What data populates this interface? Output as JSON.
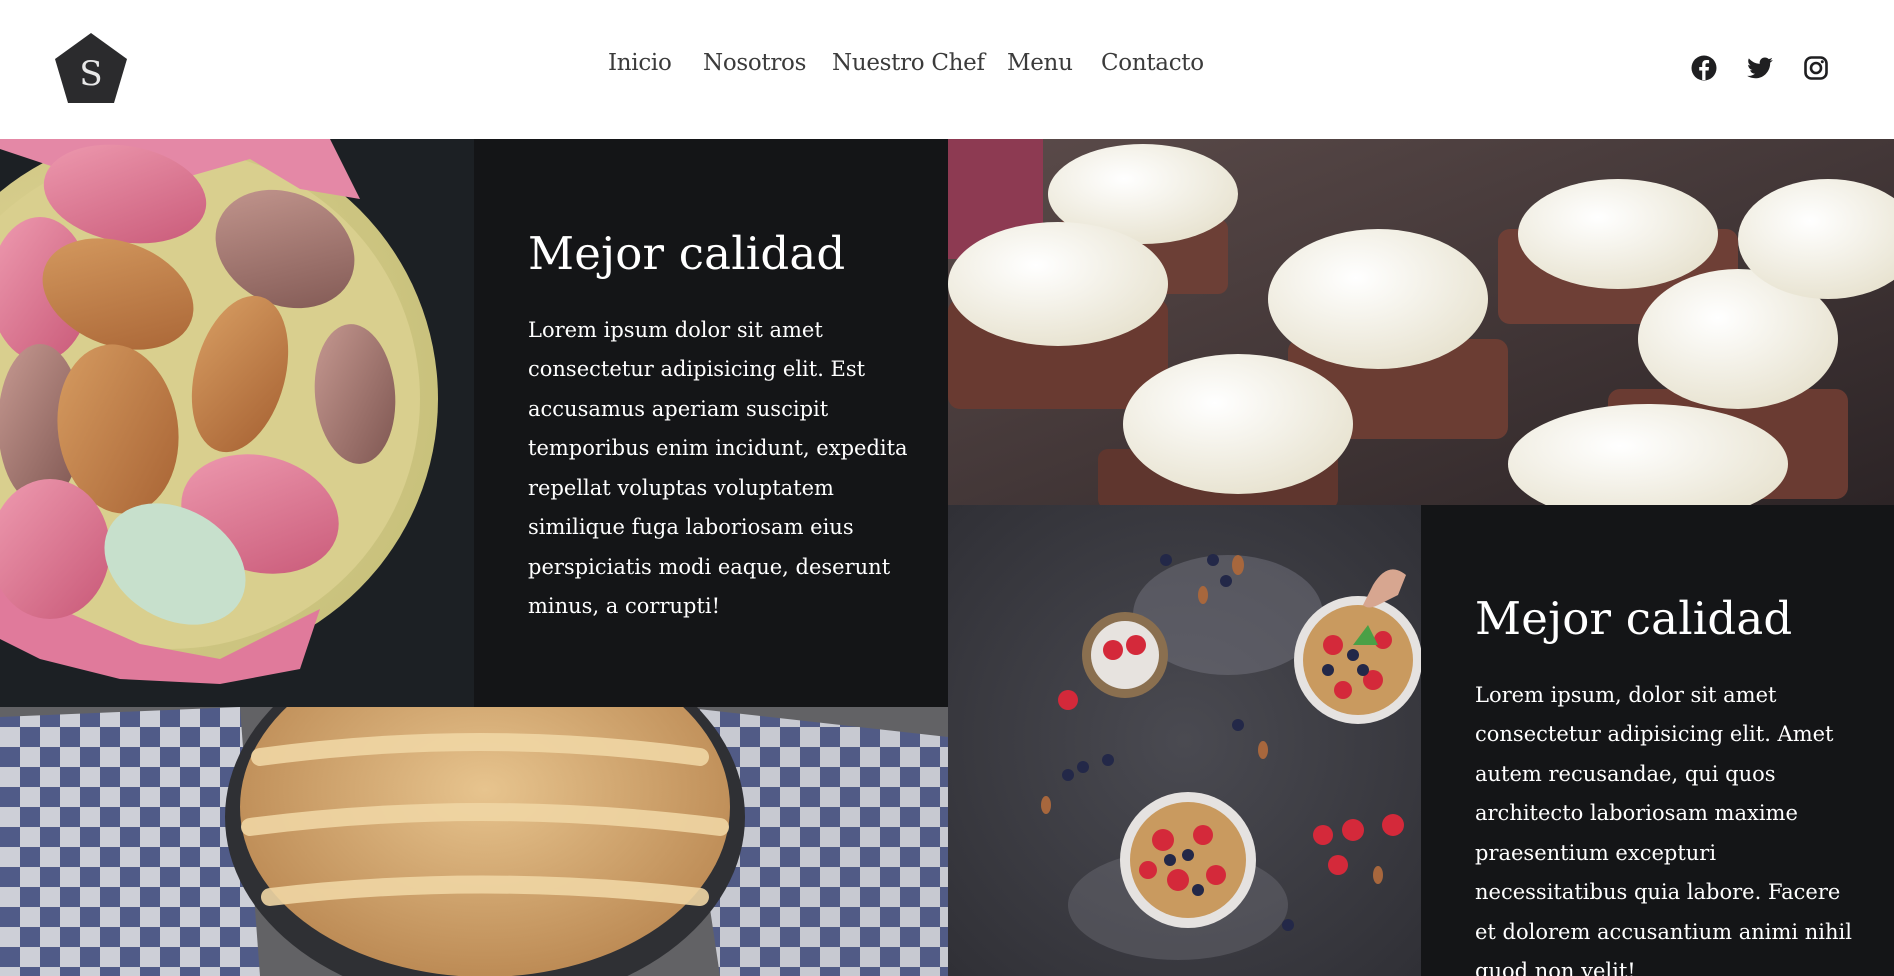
{
  "header": {
    "logo_letter": "S",
    "nav": [
      "Inicio",
      "Nosotros",
      "Nuestro Chef",
      "Menu",
      "Contacto"
    ],
    "social": [
      "facebook-icon",
      "twitter-icon",
      "instagram-icon"
    ]
  },
  "sections": [
    {
      "title": "Mejor calidad",
      "body": "Lorem ipsum dolor sit amet consectetur adipisicing elit. Est accusamus aperiam suscipit temporibus enim incidunt, expedita repellat voluptas voluptatem similique fuga laboriosam eius perspiciatis modi eaque, deserunt minus, a corrupti!"
    },
    {
      "title": "Mejor calidad",
      "body": "Lorem ipsum, dolor sit amet consectetur adipisicing elit. Amet autem recusandae, qui quos architecto laboriosam maxime praesentium excepturi necessitatibus quia labore. Facere et dolorem accusantium animi nihil quod non velit!"
    }
  ],
  "images": [
    "macarons-photo",
    "cupcakes-photo",
    "apple-pie-photo",
    "berry-bowls-photo"
  ],
  "colors": {
    "dark_panel": "#141517",
    "nav_text": "#3b3b3b",
    "logo": "#2b2b2d"
  }
}
